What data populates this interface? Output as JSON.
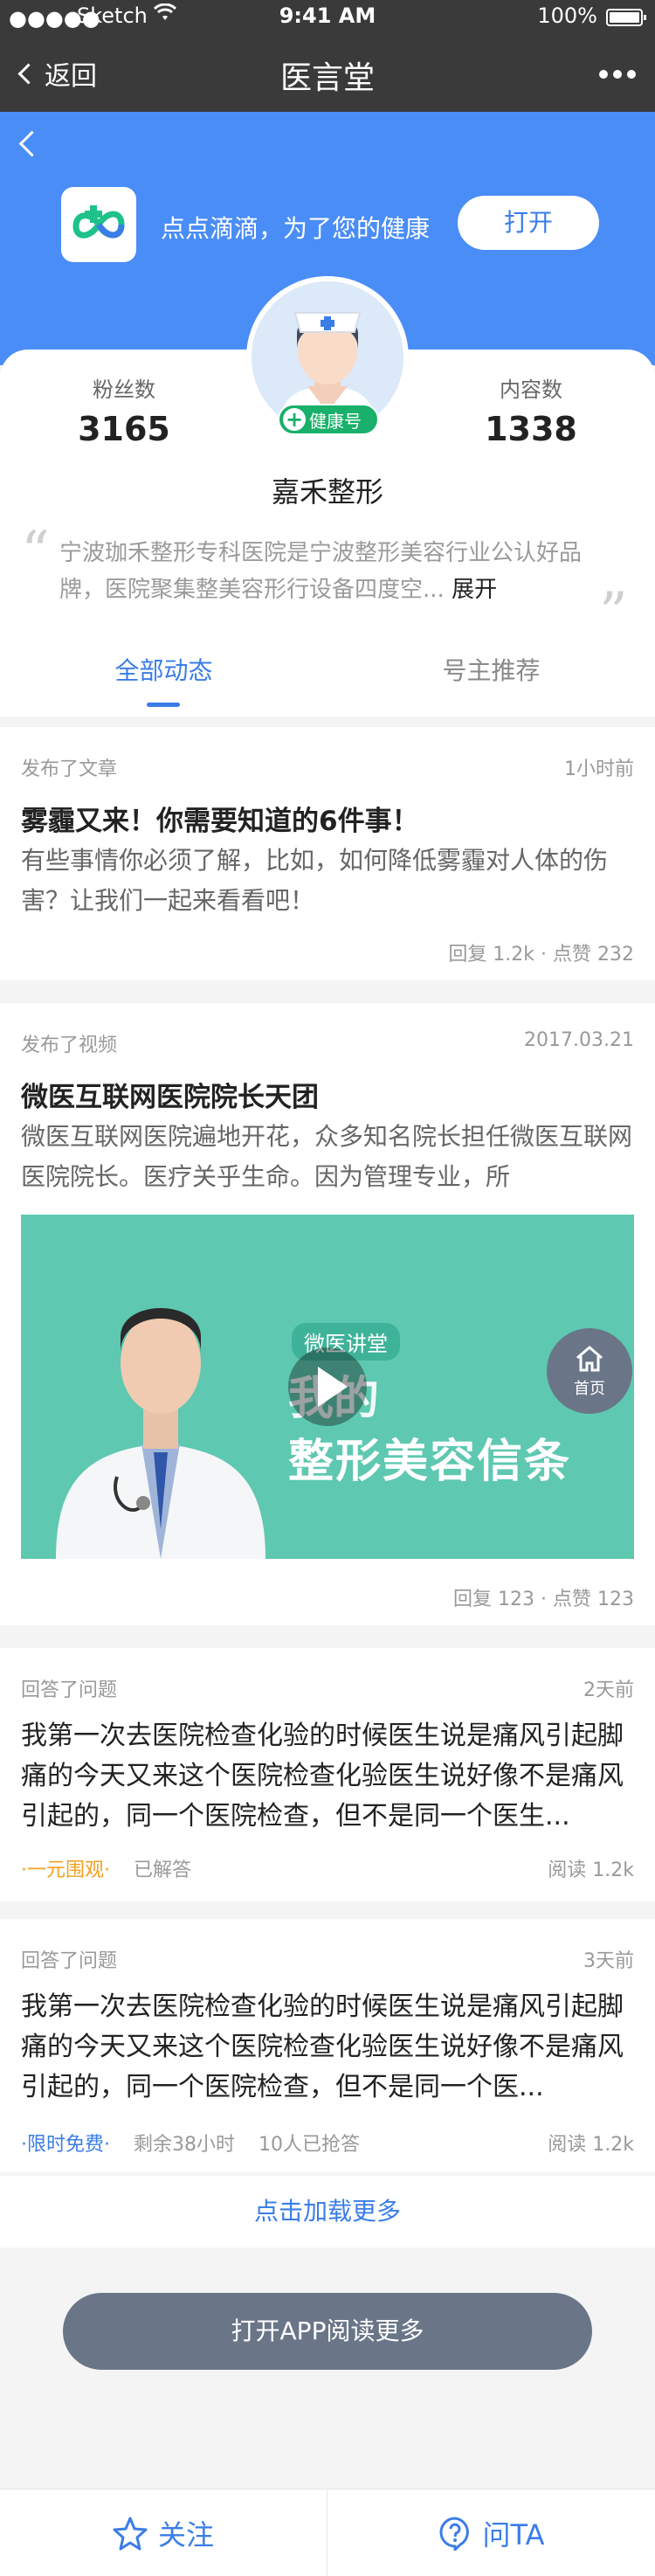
{
  "status_bar": {
    "carrier": "Sketch",
    "time": "9:41 AM",
    "battery": "100%"
  },
  "nav": {
    "back_label": "返回",
    "title": "医言堂"
  },
  "hero": {
    "slogan": "点点滴滴，为了您的健康",
    "open_label": "打开"
  },
  "profile": {
    "badge": "健康号",
    "fans_label": "粉丝数",
    "fans_count": "3165",
    "content_label": "内容数",
    "content_count": "1338",
    "name": "嘉禾整形",
    "intro": "宁波珈禾整形专科医院是宁波整形美容行业公认好品牌，医院聚集整美容形行设备四度空... ",
    "intro_expand": "展开"
  },
  "tabs": [
    {
      "label": "全部动态"
    },
    {
      "label": "号主推荐"
    }
  ],
  "feed": [
    {
      "type": "发布了文章",
      "time": "1小时前",
      "title": "雾霾又来！你需要知道的6件事！",
      "desc": "有些事情你必须了解，比如，如何降低雾霾对人体的伤害？让我们一起来看看吧！",
      "footer": "回复 1.2k · 点赞 232"
    },
    {
      "type": "发布了视频",
      "time": "2017.03.21",
      "title": "微医互联网医院院长天团",
      "desc": "微医互联网医院遍地开花，众多知名院长担任微医互联网医院院长。医疗关乎生命。因为管理专业，所",
      "video_brand": "微医讲堂",
      "video_line1": "我的",
      "video_line2": "整形美容信条",
      "footer": "回复 123 · 点赞 123"
    },
    {
      "type": "回答了问题",
      "time": "2天前",
      "question": "我第一次去医院检查化验的时候医生说是痛风引起脚痛的今天又来这个医院检查化验医生说好像不是痛风引起的，同一个医院检查，但不是同一个医生...",
      "tag": "·一元围观·",
      "status": "已解答",
      "reads": "阅读 1.2k"
    },
    {
      "type": "回答了问题",
      "time": "3天前",
      "question": "我第一次去医院检查化验的时候医生说是痛风引起脚痛的今天又来这个医院检查化验医生说好像不是痛风引起的，同一个医院检查，但不是同一个医...",
      "tag": "·限时免费·",
      "remaining": "剩余38小时",
      "grabbed": "10人已抢答",
      "reads": "阅读 1.2k"
    }
  ],
  "home_button": "首页",
  "load_more": "点击加载更多",
  "open_app": "打开APP阅读更多",
  "bottom": {
    "follow": "关注",
    "ask": "问TA"
  },
  "colors": {
    "brand_blue": "#4a8df7",
    "accent_blue": "#3a7de8",
    "badge_green": "#18b06a",
    "video_teal": "#5ec8b1",
    "button_gray": "#6a7588"
  }
}
